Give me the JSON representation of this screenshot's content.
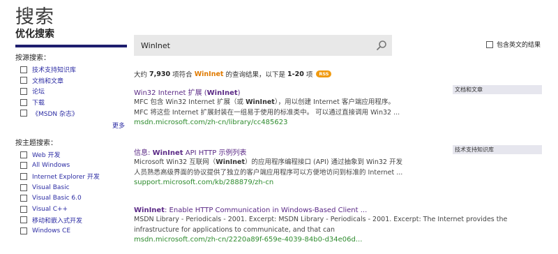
{
  "page": {
    "title": "搜索"
  },
  "sidebar": {
    "refine_title": "优化搜索",
    "source_group": {
      "title": "按源搜索：",
      "items": [
        "技术支持知识库",
        "文档和文章",
        "论坛",
        "下载",
        "《MSDN 杂志》"
      ]
    },
    "more_label": "更多",
    "topic_group": {
      "title": "按主题搜索：",
      "items": [
        "Web 开发",
        "All Windows",
        "Internet Explorer 开发",
        "Visual Basic",
        "Visual Basic 6.0",
        "Visual C++",
        "移动和嵌入式开发",
        "Windows CE"
      ]
    }
  },
  "search": {
    "value": "WinInet",
    "english_option_label": "包含英文的结果"
  },
  "summary": {
    "prefix": "大约",
    "count": "7,930",
    "mid": "项符合",
    "keyword": "WinInet",
    "suffix": "的查询结果，以下是",
    "range": "1-20",
    "unit": "项",
    "rss_label": "RSS"
  },
  "results": [
    {
      "title_pre": "Win32 Internet 扩展 (",
      "title_kw": "WinInet",
      "title_post": ")",
      "desc1_pre": "MFC 包含 Win32 Internet 扩展（或 ",
      "desc1_kw": "WinInet",
      "desc1_post": "），用以创建 Internet 客户端应用程序。",
      "desc2": "MFC 将这些 Internet 扩展封装在一组易于使用的标准类中。 可以通过直接调用 Win32 ...",
      "url": "msdn.microsoft.com/zh-cn/library/cc485623",
      "category": "文档和文章"
    },
    {
      "title_pre": "信息: ",
      "title_kw": "WinInet",
      "title_post": " API HTTP 示例列表",
      "desc1_pre": "Microsoft Win32 互联网（",
      "desc1_kw": "WinInet",
      "desc1_post": "）的应用程序编程接口 (API) 通过抽象到 Win32 开发",
      "desc2": "人员熟悉高级界面的协议提供了独立的客户端应用程序可以方便地访问到标准的 Internet ...",
      "url": "support.microsoft.com/kb/288879/zh-cn",
      "category": "技术支持知识库"
    },
    {
      "title_pre": "",
      "title_kw": "WinInet",
      "title_post": ": Enable HTTP Communication in Windows-Based Client ...",
      "desc1_pre": "MSDN Library - Periodicals - 2001. Excerpt: MSDN Library - Periodicals - 2001. Excerpt: The Internet provides the",
      "desc1_kw": "",
      "desc1_post": "",
      "desc2": "infrastructure for applications to communicate, and that can",
      "url": "msdn.microsoft.com/zh-cn/2220a89f-659e-4039-84b0-d34e06d...",
      "category": ""
    }
  ],
  "icons": {
    "search": "search-icon",
    "checkbox": "checkbox-icon"
  },
  "colors": {
    "accent_bar": "#1e1e6e",
    "link": "#2b2ba3",
    "result_title": "#5b2a86",
    "url": "#2e8b2e",
    "keyword": "#e07a00",
    "rss": "#f09a10"
  }
}
